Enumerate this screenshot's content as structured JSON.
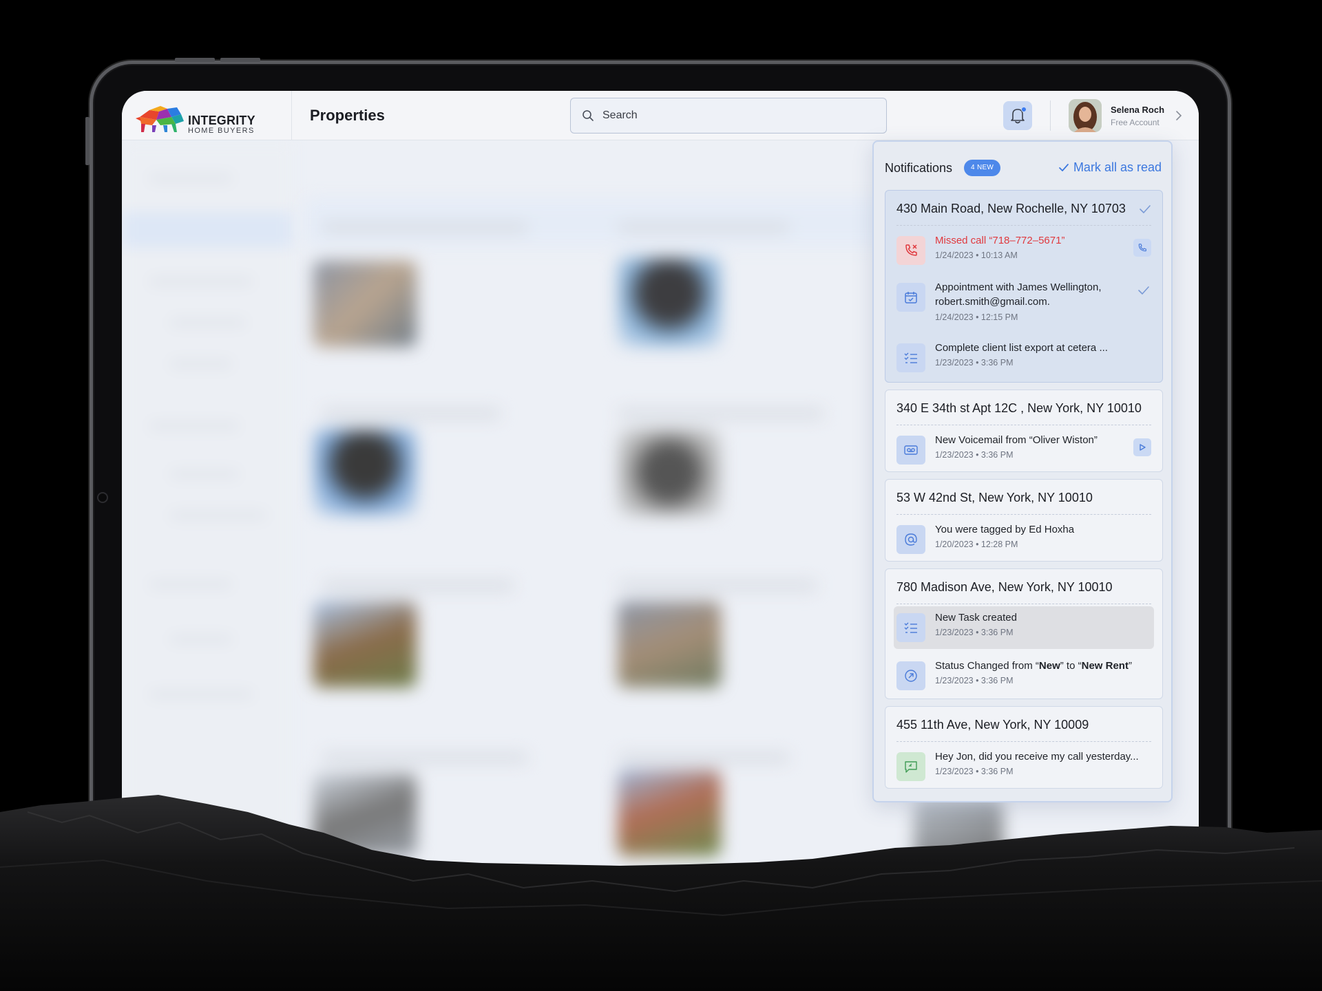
{
  "app": {
    "logo_title": "INTEGRITY",
    "logo_subtitle": "HOME BUYERS",
    "page_title": "Properties"
  },
  "search": {
    "placeholder": "Search"
  },
  "user": {
    "name": "Selena Roch",
    "role": "Free Account"
  },
  "notifications": {
    "title": "Notifications",
    "new_badge": "4 NEW",
    "mark_all_label": "Mark all as read",
    "groups": [
      {
        "address": "430 Main Road, New Rochelle, NY 10703",
        "items": [
          {
            "icon": "missed-call-icon",
            "title": "Missed call “718–772–5671”",
            "time": "1/24/2023 • 10:13 AM",
            "action": "phone-icon"
          },
          {
            "icon": "calendar-icon",
            "title": "Appointment with James Wellington, robert.smith@gmail.com.",
            "time": "1/24/2023 • 12:15 PM",
            "action": "check-icon"
          },
          {
            "icon": "task-list-icon",
            "title": "Complete client list export at cetera ...",
            "time": "1/23/2023 • 3:36 PM"
          }
        ]
      },
      {
        "address": "340 E 34th st Apt 12C , New York, NY 10010",
        "items": [
          {
            "icon": "voicemail-icon",
            "title": "New Voicemail from “Oliver Wiston”",
            "time": "1/23/2023 • 3:36 PM",
            "action": "play-icon"
          }
        ]
      },
      {
        "address": "53 W 42nd St, New York, NY 10010",
        "items": [
          {
            "icon": "at-sign-icon",
            "title": "You were tagged by Ed Hoxha",
            "time": "1/20/2023 • 12:28 PM"
          }
        ]
      },
      {
        "address": "780 Madison Ave, New York, NY 10010",
        "items": [
          {
            "icon": "task-list-icon",
            "title": "New Task created",
            "time": "1/23/2023 • 3:36 PM"
          },
          {
            "icon": "status-change-icon",
            "title_prefix": "Status Changed from “",
            "title_from": "New",
            "title_mid": "” to “",
            "title_to": "New Rent",
            "title_suffix": "”",
            "time": "1/23/2023 • 3:36 PM"
          }
        ]
      },
      {
        "address": "455 11th Ave, New York, NY 10009",
        "items": [
          {
            "icon": "message-icon",
            "title": "Hey Jon, did you receive my call yesterday...",
            "time": "1/23/2023 • 3:36 PM"
          }
        ]
      }
    ]
  },
  "colors": {
    "accent": "#3c78df",
    "badge": "#4d88ea",
    "missed": "#e0393e"
  }
}
